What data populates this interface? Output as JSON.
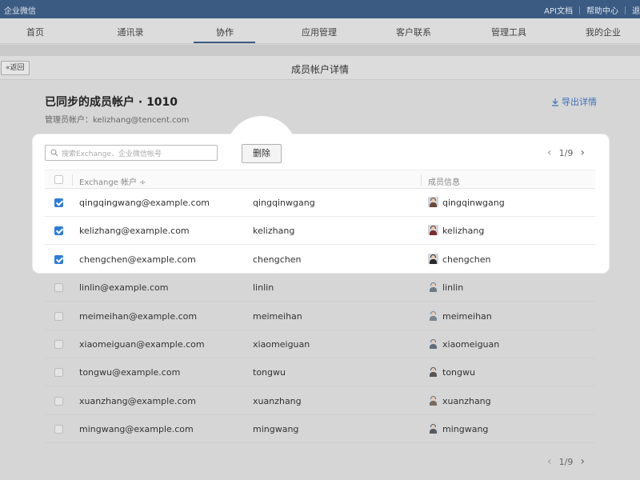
{
  "topbar": {
    "brand": "企业微信",
    "links": [
      "API文档",
      "帮助中心",
      "退"
    ]
  },
  "nav": {
    "tabs": [
      "首页",
      "通讯录",
      "协作",
      "应用管理",
      "客户联系",
      "管理工具",
      "我的企业"
    ],
    "active_index": 2
  },
  "titlebar": {
    "back_label": "«返回",
    "title": "成员帐户详情"
  },
  "section": {
    "title": "已同步的成员帐户 · 1010",
    "admin": "管理员帐户：kelizhang@tencent.com",
    "export_label": "导出详情"
  },
  "toolbar": {
    "search_placeholder": "搜索Exchange、企业微信帐号",
    "delete_label": "删除"
  },
  "pager_top": {
    "label": "1/9"
  },
  "pager_bottom": {
    "label": "1/9"
  },
  "table": {
    "headers": [
      "Exchange 帐户 ÷",
      "",
      "成员信息"
    ],
    "rows": [
      {
        "email": "qingqingwang@example.com",
        "account": "qingqinwgang",
        "member": "qingqinwgang",
        "checked": true,
        "avatar_color": "#6b4a3a"
      },
      {
        "email": "kelizhang@example.com",
        "account": "kelizhang",
        "member": "kelizhang",
        "checked": true,
        "avatar_color": "#7a2e2e"
      },
      {
        "email": "chengchen@example.com",
        "account": "chengchen",
        "member": "chengchen",
        "checked": true,
        "avatar_color": "#2b2b2b"
      },
      {
        "email": "linlin@example.com",
        "account": "linlin",
        "member": "linlin",
        "checked": false,
        "avatar_color": "#4a5a6a"
      },
      {
        "email": "meimeihan@example.com",
        "account": "meimeihan",
        "member": "meimeihan",
        "checked": false,
        "avatar_color": "#5a6b7a"
      },
      {
        "email": "xiaomeiguan@example.com",
        "account": "xiaomeiguan",
        "member": "xiaomeiguan",
        "checked": false,
        "avatar_color": "#3a4a5a"
      },
      {
        "email": "tongwu@example.com",
        "account": "tongwu",
        "member": "tongwu",
        "checked": false,
        "avatar_color": "#2a2a2a"
      },
      {
        "email": "xuanzhang@example.com",
        "account": "xuanzhang",
        "member": "xuanzhang",
        "checked": false,
        "avatar_color": "#5b4636"
      },
      {
        "email": "mingwang@example.com",
        "account": "mingwang",
        "member": "mingwang",
        "checked": false,
        "avatar_color": "#2b3340"
      }
    ]
  },
  "icons": {
    "search": "search-icon",
    "export": "download-icon",
    "prev": "chevron-left-icon",
    "next": "chevron-right-icon"
  },
  "colors": {
    "topbar": "#3b5b82",
    "accent": "#2e7cd8",
    "link": "#3b73b9"
  }
}
